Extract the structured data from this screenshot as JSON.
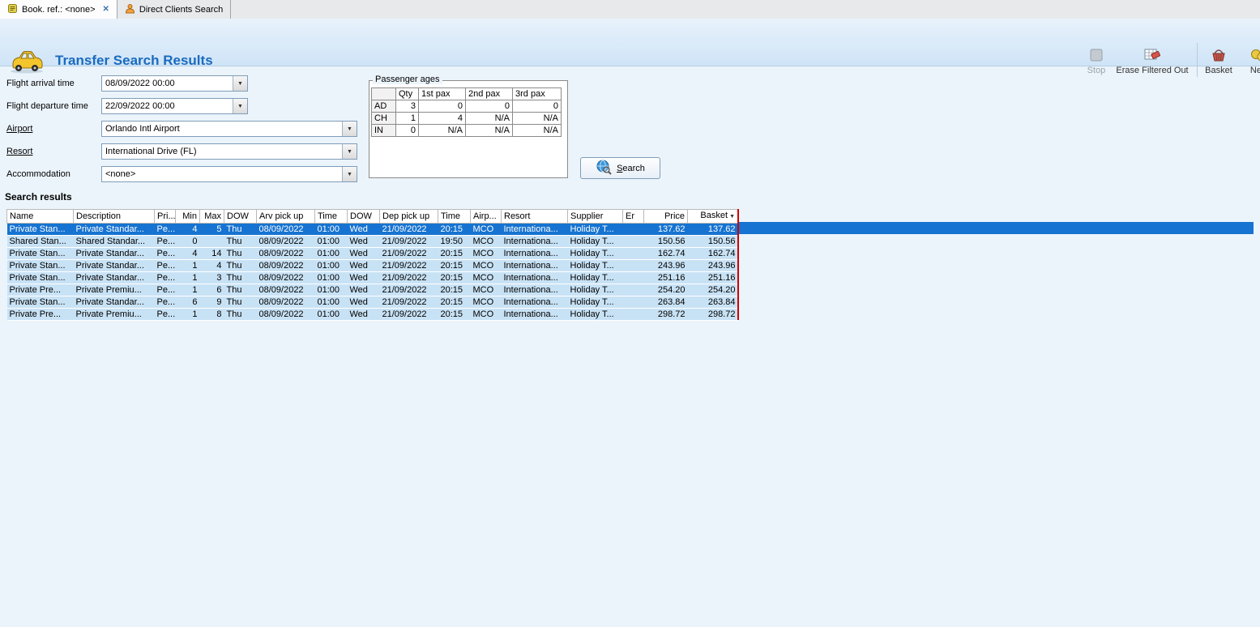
{
  "tabs": [
    {
      "label": "Book. ref.: <none>"
    },
    {
      "label": "Direct Clients Search"
    }
  ],
  "header": {
    "title": "Transfer Search Results",
    "toolbar": {
      "stop": "Stop",
      "erase_filtered_out": "Erase Filtered Out",
      "basket": "Basket",
      "nett": "Nett"
    }
  },
  "form": {
    "fields": [
      {
        "label": "Flight arrival time",
        "value": "08/09/2022 00:00"
      },
      {
        "label": "Flight departure time",
        "value": "22/09/2022 00:00"
      },
      {
        "label": "Airport",
        "value": "Orlando Intl Airport"
      },
      {
        "label": "Resort",
        "value": "International Drive (FL)"
      },
      {
        "label": "Accommodation",
        "value": "<none>"
      }
    ]
  },
  "passenger_ages": {
    "title": "Passenger ages",
    "columns": [
      "",
      "Qty",
      "1st pax",
      "2nd pax",
      "3rd pax"
    ],
    "rows": [
      {
        "label": "AD",
        "qty": "3",
        "pax1": "0",
        "pax2": "0",
        "pax3": "0"
      },
      {
        "label": "CH",
        "qty": "1",
        "pax1": "4",
        "pax2": "N/A",
        "pax3": "N/A"
      },
      {
        "label": "IN",
        "qty": "0",
        "pax1": "N/A",
        "pax2": "N/A",
        "pax3": "N/A"
      }
    ]
  },
  "search_button_label": "Search",
  "results": {
    "section_title": "Search results",
    "columns": [
      "Name",
      "Description",
      "Pri...",
      "Min",
      "Max",
      "DOW",
      "Arv pick up",
      "Time",
      "DOW",
      "Dep pick up",
      "Time",
      "Airp...",
      "Resort",
      "Supplier",
      "Er",
      "Price",
      "Basket"
    ],
    "sorted_column": 16,
    "sort_indicator": "▼",
    "selected_index": 0,
    "rows": [
      [
        "Private Stan...",
        "Private Standar...",
        "Pe...",
        "4",
        "5",
        "Thu",
        "08/09/2022",
        "01:00",
        "Wed",
        "21/09/2022",
        "20:15",
        "MCO",
        "Internationa...",
        "Holiday T...",
        "",
        "137.62",
        "137.62"
      ],
      [
        "Shared Stan...",
        "Shared Standar...",
        "Pe...",
        "0",
        "",
        "Thu",
        "08/09/2022",
        "01:00",
        "Wed",
        "21/09/2022",
        "19:50",
        "MCO",
        "Internationa...",
        "Holiday T...",
        "",
        "150.56",
        "150.56"
      ],
      [
        "Private Stan...",
        "Private Standar...",
        "Pe...",
        "4",
        "14",
        "Thu",
        "08/09/2022",
        "01:00",
        "Wed",
        "21/09/2022",
        "20:15",
        "MCO",
        "Internationa...",
        "Holiday T...",
        "",
        "162.74",
        "162.74"
      ],
      [
        "Private Stan...",
        "Private Standar...",
        "Pe...",
        "1",
        "4",
        "Thu",
        "08/09/2022",
        "01:00",
        "Wed",
        "21/09/2022",
        "20:15",
        "MCO",
        "Internationa...",
        "Holiday T...",
        "",
        "243.96",
        "243.96"
      ],
      [
        "Private Stan...",
        "Private Standar...",
        "Pe...",
        "1",
        "3",
        "Thu",
        "08/09/2022",
        "01:00",
        "Wed",
        "21/09/2022",
        "20:15",
        "MCO",
        "Internationa...",
        "Holiday T...",
        "",
        "251.16",
        "251.16"
      ],
      [
        "Private Pre...",
        "Private Premiu...",
        "Pe...",
        "1",
        "6",
        "Thu",
        "08/09/2022",
        "01:00",
        "Wed",
        "21/09/2022",
        "20:15",
        "MCO",
        "Internationa...",
        "Holiday T...",
        "",
        "254.20",
        "254.20"
      ],
      [
        "Private Stan...",
        "Private Standar...",
        "Pe...",
        "6",
        "9",
        "Thu",
        "08/09/2022",
        "01:00",
        "Wed",
        "21/09/2022",
        "20:15",
        "MCO",
        "Internationa...",
        "Holiday T...",
        "",
        "263.84",
        "263.84"
      ],
      [
        "Private Pre...",
        "Private Premiu...",
        "Pe...",
        "1",
        "8",
        "Thu",
        "08/09/2022",
        "01:00",
        "Wed",
        "21/09/2022",
        "20:15",
        "MCO",
        "Internationa...",
        "Holiday T...",
        "",
        "298.72",
        "298.72"
      ]
    ]
  }
}
